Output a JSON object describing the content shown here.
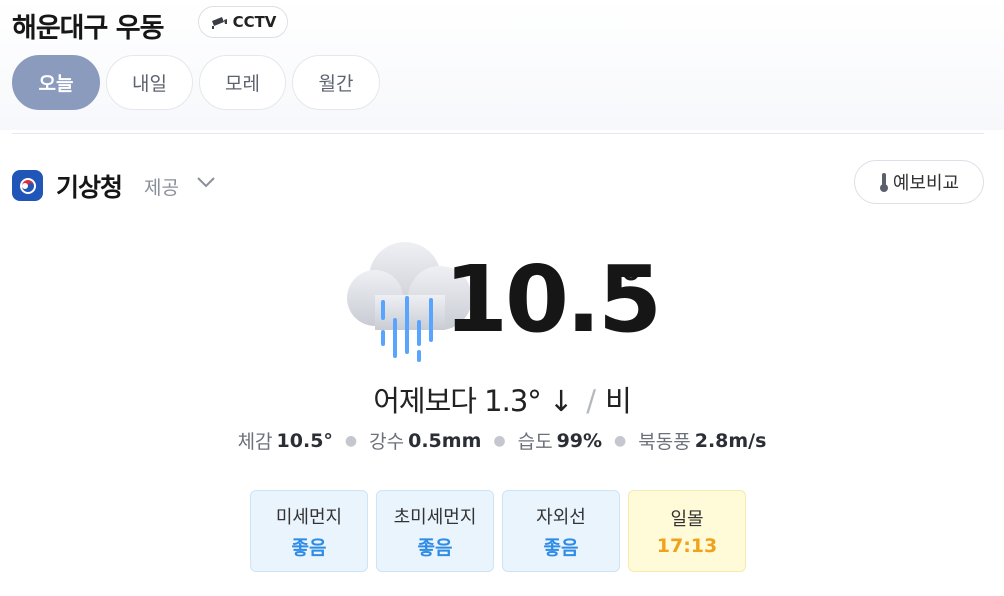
{
  "header": {
    "location": "해운대구 우동",
    "cctv_label": "CCTV"
  },
  "tabs": [
    {
      "label": "오늘",
      "active": true
    },
    {
      "label": "내일",
      "active": false
    },
    {
      "label": "모레",
      "active": false
    },
    {
      "label": "월간",
      "active": false
    }
  ],
  "provider": {
    "name": "기상청",
    "suffix": "제공",
    "compare_label": "예보비교"
  },
  "current": {
    "temperature": "10.5",
    "degree": "°",
    "comparison": "어제보다 1.3° ↓",
    "condition": "비",
    "icon": "rain-cloud-icon"
  },
  "stats": [
    {
      "label": "체감",
      "value": "10.5°"
    },
    {
      "label": "강수",
      "value": "0.5mm"
    },
    {
      "label": "습도",
      "value": "99%"
    },
    {
      "label": "북동풍",
      "value": "2.8m/s"
    }
  ],
  "cards": [
    {
      "label": "미세먼지",
      "value": "좋음"
    },
    {
      "label": "초미세먼지",
      "value": "좋음"
    },
    {
      "label": "자외선",
      "value": "좋음"
    },
    {
      "label": "일몰",
      "value": "17:13"
    }
  ],
  "colors": {
    "tab_active": "#8a9bbd",
    "good_status": "#2f8ce6",
    "sunset": "#f0a21b",
    "provider_logo": "#1f56b8"
  }
}
